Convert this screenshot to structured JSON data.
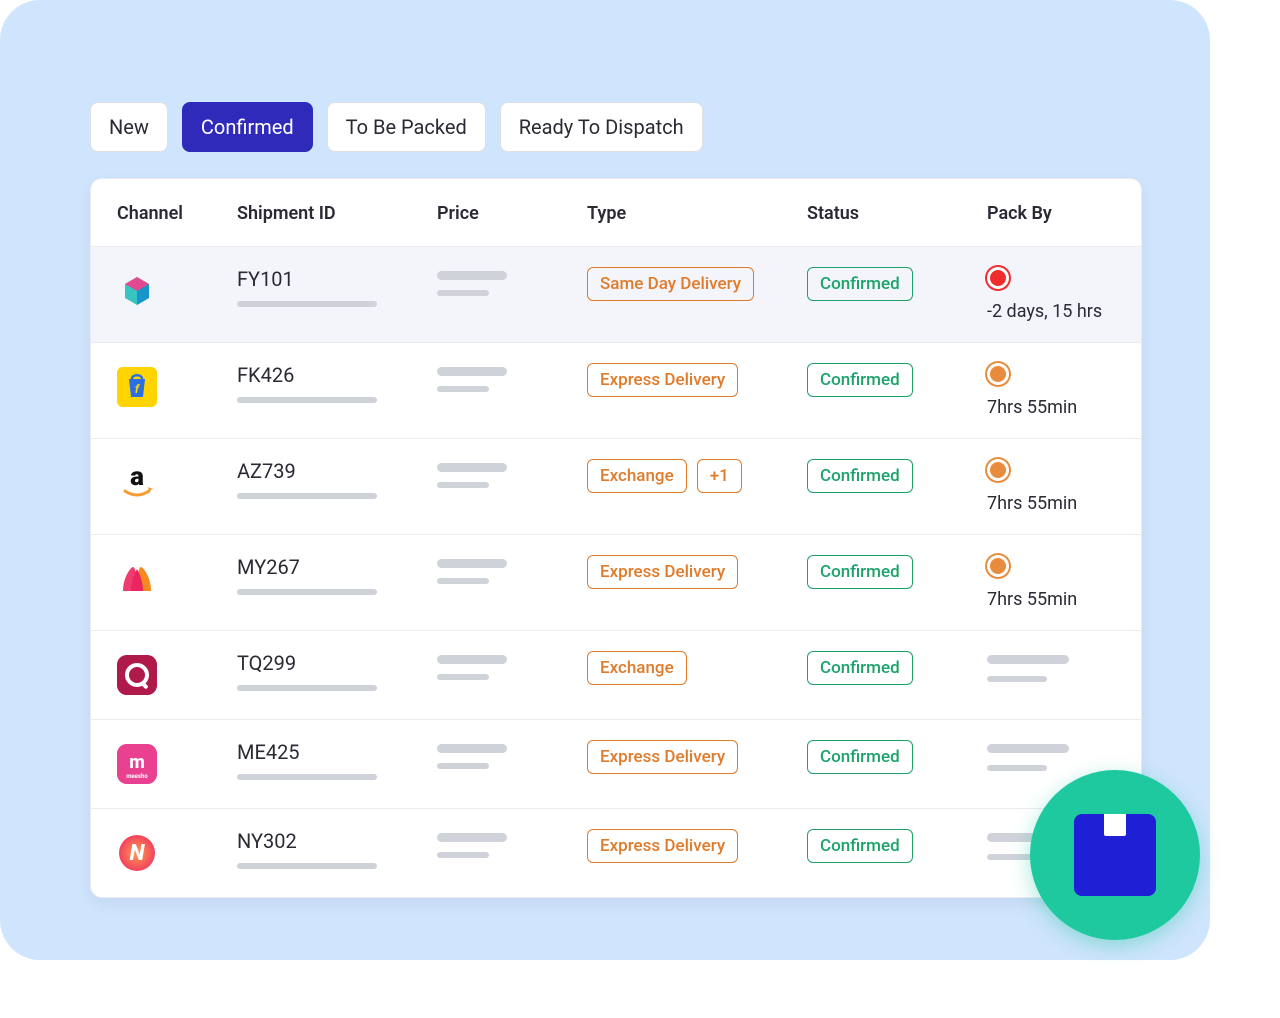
{
  "tabs": [
    {
      "label": "New",
      "active": false
    },
    {
      "label": "Confirmed",
      "active": true
    },
    {
      "label": "To Be Packed",
      "active": false
    },
    {
      "label": "Ready To Dispatch",
      "active": false
    }
  ],
  "columns": {
    "channel": "Channel",
    "shipment_id": "Shipment ID",
    "price": "Price",
    "type": "Type",
    "status": "Status",
    "pack_by": "Pack By"
  },
  "rows": [
    {
      "channel": "fynd",
      "shipment_id": "FY101",
      "type_tags": [
        "Same Day Delivery"
      ],
      "status": "Confirmed",
      "pack_by": {
        "dot": "red",
        "text": "-2 days, 15 hrs"
      },
      "hovered": true
    },
    {
      "channel": "flipkart",
      "shipment_id": "FK426",
      "type_tags": [
        "Express Delivery"
      ],
      "status": "Confirmed",
      "pack_by": {
        "dot": "amber",
        "text": "7hrs 55min"
      }
    },
    {
      "channel": "amazon",
      "shipment_id": "AZ739",
      "type_tags": [
        "Exchange",
        "+1"
      ],
      "status": "Confirmed",
      "pack_by": {
        "dot": "amber",
        "text": "7hrs 55min"
      }
    },
    {
      "channel": "myntra",
      "shipment_id": "MY267",
      "type_tags": [
        "Express Delivery"
      ],
      "status": "Confirmed",
      "pack_by": {
        "dot": "amber",
        "text": "7hrs 55min"
      }
    },
    {
      "channel": "tataq",
      "shipment_id": "TQ299",
      "type_tags": [
        "Exchange"
      ],
      "status": "Confirmed",
      "pack_by": null
    },
    {
      "channel": "meesho",
      "shipment_id": "ME425",
      "type_tags": [
        "Express Delivery"
      ],
      "status": "Confirmed",
      "pack_by": null
    },
    {
      "channel": "nykaa",
      "shipment_id": "NY302",
      "type_tags": [
        "Express Delivery"
      ],
      "status": "Confirmed",
      "pack_by": null
    }
  ],
  "icons": {
    "fynd": {
      "bg": "transparent"
    },
    "flipkart": {
      "bg": "#ffd400"
    },
    "amazon": {
      "bg": "transparent"
    },
    "myntra": {
      "bg": "transparent"
    },
    "tataq": {
      "bg": "#b01a4a"
    },
    "meesho": {
      "bg": "#e9418f"
    },
    "nykaa": {
      "bg": "transparent"
    }
  }
}
